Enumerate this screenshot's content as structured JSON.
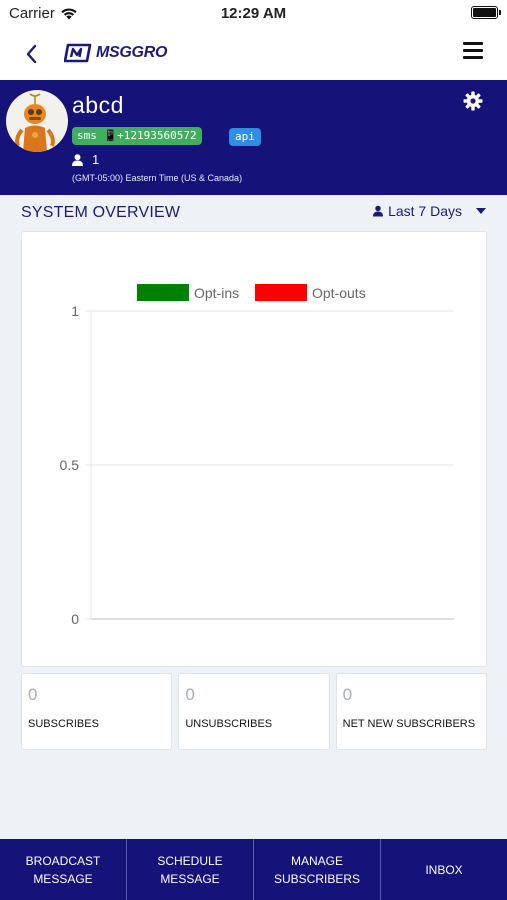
{
  "status_bar": {
    "carrier": "Carrier",
    "time": "12:29 AM"
  },
  "nav": {
    "logo_text": "MSGGRO"
  },
  "profile": {
    "name": "abcd",
    "sms_badge": "sms 📱+12193560572",
    "api_badge": "api",
    "user_count": "1",
    "timezone": "(GMT-05:00) Eastern Time (US & Canada)"
  },
  "overview": {
    "title": "SYSTEM OVERVIEW",
    "range_label": "Last 7 Days"
  },
  "chart_data": {
    "type": "line",
    "title": "",
    "xlabel": "",
    "ylabel": "",
    "ylim": [
      0,
      1
    ],
    "yticks": [
      "1",
      "0.5",
      "0"
    ],
    "grid": true,
    "legend_position": "top",
    "series": [
      {
        "name": "Opt-ins",
        "color": "#008000",
        "values": []
      },
      {
        "name": "Opt-outs",
        "color": "#ff0000",
        "values": []
      }
    ]
  },
  "stats": [
    {
      "value": "0",
      "label": "SUBSCRIBES"
    },
    {
      "value": "0",
      "label": "UNSUBSCRIBES"
    },
    {
      "value": "0",
      "label": "NET NEW SUBSCRIBERS"
    }
  ],
  "bottom_nav": [
    {
      "label": "BROADCAST\nMESSAGE"
    },
    {
      "label": "SCHEDULE MESSAGE"
    },
    {
      "label": "MANAGE\nSUBSCRIBERS"
    },
    {
      "label": "INBOX"
    }
  ],
  "colors": {
    "primary": "#15127a",
    "sms_badge": "#3fae5f",
    "api_badge": "#2e8ee0",
    "background": "#eef1f6"
  }
}
